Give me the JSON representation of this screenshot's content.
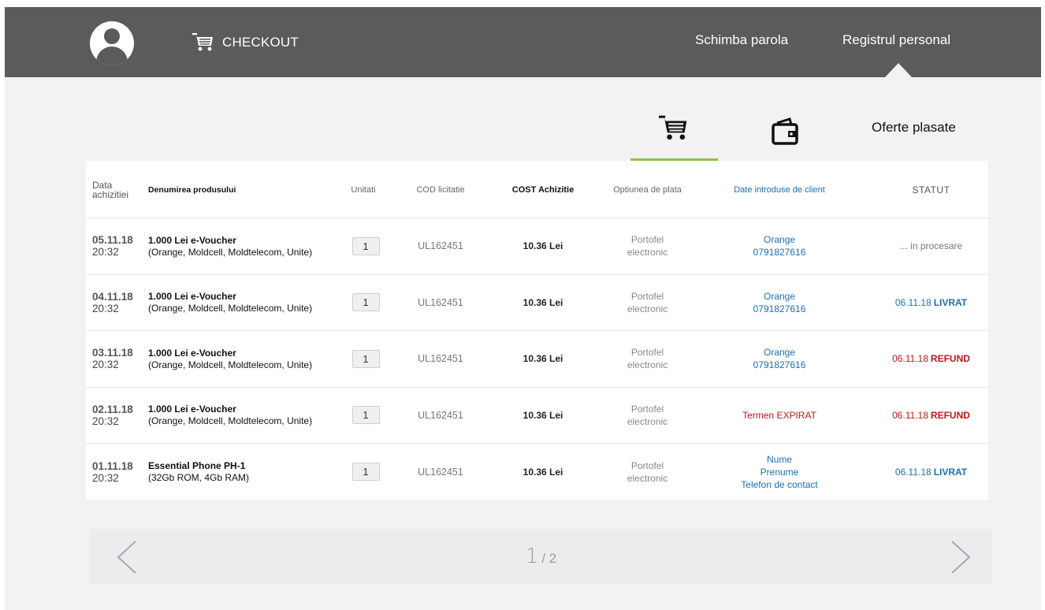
{
  "header": {
    "brand_label": "CHECKOUT",
    "nav": [
      {
        "label": "Schimba parola"
      },
      {
        "label": "Registrul personal"
      }
    ]
  },
  "subtabs": {
    "offers_label": "Oferte plasate",
    "active": "cart",
    "accent": "#8bc34a"
  },
  "table": {
    "headers": {
      "date": "Data achizitiei",
      "name": "Denumirea produsului",
      "units": "Unitati",
      "cod": "COD licitatie",
      "cost": "COST Achizitie",
      "payment": "Optiunea de plata",
      "client": "Date introduse de client",
      "status": "STATUT"
    },
    "rows": [
      {
        "date": "05.11.18",
        "time": "20:32",
        "product": "1.000 Lei e-Voucher",
        "product_detail": "(Orange, Moldcell, Moldtelecom, Unite)",
        "units": "1",
        "cod": "UL162451",
        "cost": "10.36 Lei",
        "payment_1": "Portofel",
        "payment_2": "electronic",
        "client_1": "Orange",
        "client_2": "0791827616",
        "client_3": "",
        "status_date": "",
        "status_text": "... in procesare",
        "status_color": "grey"
      },
      {
        "date": "04.11.18",
        "time": "20:32",
        "product": "1.000 Lei e-Voucher",
        "product_detail": "(Orange, Moldcell, Moldtelecom, Unite)",
        "units": "1",
        "cod": "UL162451",
        "cost": "10.36 Lei",
        "payment_1": "Portofel",
        "payment_2": "electronic",
        "client_1": "Orange",
        "client_2": "0791827616",
        "client_3": "",
        "status_date": "06.11.18",
        "status_text": "LIVRAT",
        "status_color": "blue"
      },
      {
        "date": "03.11.18",
        "time": "20:32",
        "product": "1.000 Lei e-Voucher",
        "product_detail": "(Orange, Moldcell, Moldtelecom, Unite)",
        "units": "1",
        "cod": "UL162451",
        "cost": "10.36 Lei",
        "payment_1": "Portofel",
        "payment_2": "electronic",
        "client_1": "Orange",
        "client_2": "0791827616",
        "client_3": "",
        "status_date": "06.11.18",
        "status_text": "REFUND",
        "status_color": "red"
      },
      {
        "date": "02.11.18",
        "time": "20:32",
        "product": "1.000 Lei e-Voucher",
        "product_detail": "(Orange, Moldcell, Moldtelecom, Unite)",
        "units": "1",
        "cod": "UL162451",
        "cost": "10.36 Lei",
        "payment_1": "Portofel",
        "payment_2": "electronic",
        "client_1": "Termen EXPIRAT",
        "client_2": "",
        "client_3": "",
        "client_expired": true,
        "status_date": "06.11.18",
        "status_text": "REFUND",
        "status_color": "red"
      },
      {
        "date": "01.11.18",
        "time": "20:32",
        "product": "Essential Phone PH-1",
        "product_detail": "(32Gb ROM, 4Gb RAM)",
        "units": "1",
        "cod": "UL162451",
        "cost": "10.36 Lei",
        "payment_1": "Portofel",
        "payment_2": "electronic",
        "client_1": "Nume",
        "client_2": "Prenume",
        "client_3": "Telefon de contact",
        "status_date": "06.11.18",
        "status_text": "LIVRAT",
        "status_color": "blue"
      }
    ]
  },
  "pagination": {
    "current": "1",
    "total": "/ 2"
  },
  "colors": {
    "topbar": "#5b5b5b",
    "link_blue": "#1a6fb3",
    "refund_red": "#c0151c"
  }
}
